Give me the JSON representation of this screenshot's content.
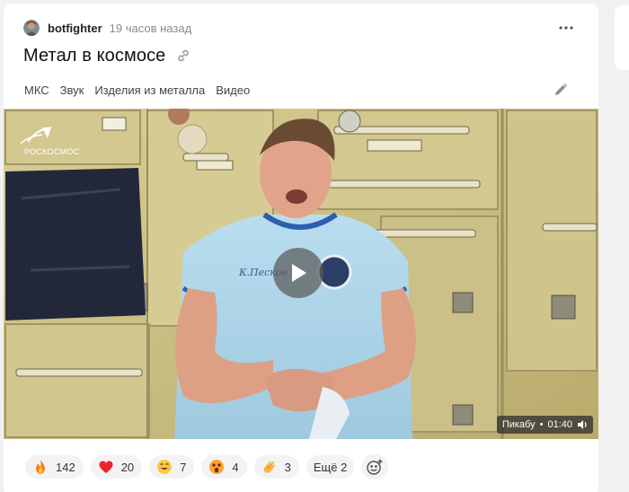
{
  "post": {
    "author": "botfighter",
    "time": "19 часов назад",
    "title": "Метал в космосе",
    "tags": [
      "МКС",
      "Звук",
      "Изделия из металла",
      "Видео"
    ]
  },
  "video": {
    "source": "Пикабу",
    "separator": "•",
    "duration": "01:40",
    "watermark": "РОСКОСМОС",
    "shirt_text": "К.Песков"
  },
  "reactions": [
    {
      "icon": "fire-icon",
      "count": "142"
    },
    {
      "icon": "heart-icon",
      "count": "20"
    },
    {
      "icon": "smiling-face-icon",
      "count": "7"
    },
    {
      "icon": "shocked-face-icon",
      "count": "4"
    },
    {
      "icon": "clapping-hands-icon",
      "count": "3"
    }
  ],
  "more_reactions": "Ещё 2",
  "colors": {
    "accent": "#f3f3f3",
    "heart": "#e8262b",
    "fire": "#ff7a1a"
  }
}
